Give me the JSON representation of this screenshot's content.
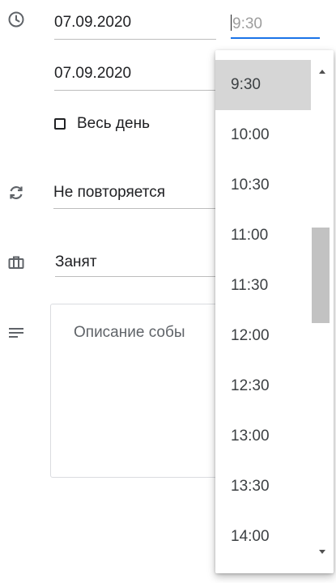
{
  "event_form": {
    "start_date": "07.09.2020",
    "end_date": "07.09.2020",
    "start_time_value": "9:30",
    "all_day_label": "Весь день",
    "repeat_value": "Не повторяется",
    "availability_value": "Занят",
    "description_placeholder": "Описание собы"
  },
  "icons": {
    "clock": "clock-icon",
    "repeat": "repeat-icon",
    "availability": "briefcase-icon",
    "description": "notes-icon"
  },
  "time_dropdown": {
    "selected": "9:30",
    "options": [
      "9:30",
      "10:00",
      "10:30",
      "11:00",
      "11:30",
      "12:00",
      "12:30",
      "13:00",
      "13:30",
      "14:00"
    ],
    "scroll_position": 0.4
  },
  "colors": {
    "focus_accent": "#1a73e8",
    "selected_bg": "#d6d6d6",
    "icon": "#5f6368"
  }
}
